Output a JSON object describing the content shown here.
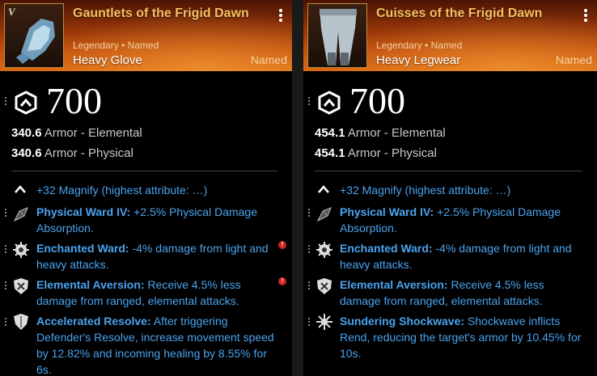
{
  "items": [
    {
      "roman": "V",
      "name": "Gauntlets of the Frigid Dawn",
      "rarity": "Legendary • Named",
      "type": "Heavy Glove",
      "named": "Named",
      "gear_score": "700",
      "armor": [
        {
          "value": "340.6",
          "label": "Armor - Elemental"
        },
        {
          "value": "340.6",
          "label": "Armor - Physical"
        }
      ],
      "magnify": "+32 Magnify (highest attribute: …)",
      "perks": [
        {
          "name": "Physical Ward IV:",
          "text": " +2.5% Physical Damage Absorption.",
          "icon": "ward-gem-icon",
          "warning": false
        },
        {
          "name": "Enchanted Ward:",
          "text": " -4% damage from light and heavy attacks.",
          "icon": "enchanted-ward-icon",
          "warning": true
        },
        {
          "name": "Elemental Aversion:",
          "text": " Receive 4.5% less damage from ranged, elemental attacks.",
          "icon": "elemental-aversion-icon",
          "warning": true
        },
        {
          "name": "Accelerated Resolve:",
          "text": " After triggering Defender's Resolve, increase movement speed by 12.82% and incoming healing by 8.55% for 6s.",
          "icon": "shield-icon",
          "warning": false
        }
      ]
    },
    {
      "roman": "",
      "name": "Cuisses of the Frigid Dawn",
      "rarity": "Legendary • Named",
      "type": "Heavy Legwear",
      "named": "Named",
      "gear_score": "700",
      "armor": [
        {
          "value": "454.1",
          "label": "Armor - Elemental"
        },
        {
          "value": "454.1",
          "label": "Armor - Physical"
        }
      ],
      "magnify": "+32 Magnify (highest attribute: …)",
      "perks": [
        {
          "name": "Physical Ward IV:",
          "text": " +2.5% Physical Damage Absorption.",
          "icon": "ward-gem-icon",
          "warning": false
        },
        {
          "name": "Enchanted Ward:",
          "text": " -4% damage from light and heavy attacks.",
          "icon": "enchanted-ward-icon",
          "warning": true
        },
        {
          "name": "Elemental Aversion:",
          "text": " Receive 4.5% less damage from ranged, elemental attacks.",
          "icon": "elemental-aversion-icon",
          "warning": true
        },
        {
          "name": "Sundering Shockwave:",
          "text": " Shockwave inflicts Rend, reducing the target's armor by 10.45% for 10s.",
          "icon": "shockwave-icon",
          "warning": false
        }
      ]
    }
  ],
  "colors": {
    "perk_blue": "#4aa3ee",
    "title_gold": "#f4c060",
    "header_orange": "#c2500f"
  }
}
